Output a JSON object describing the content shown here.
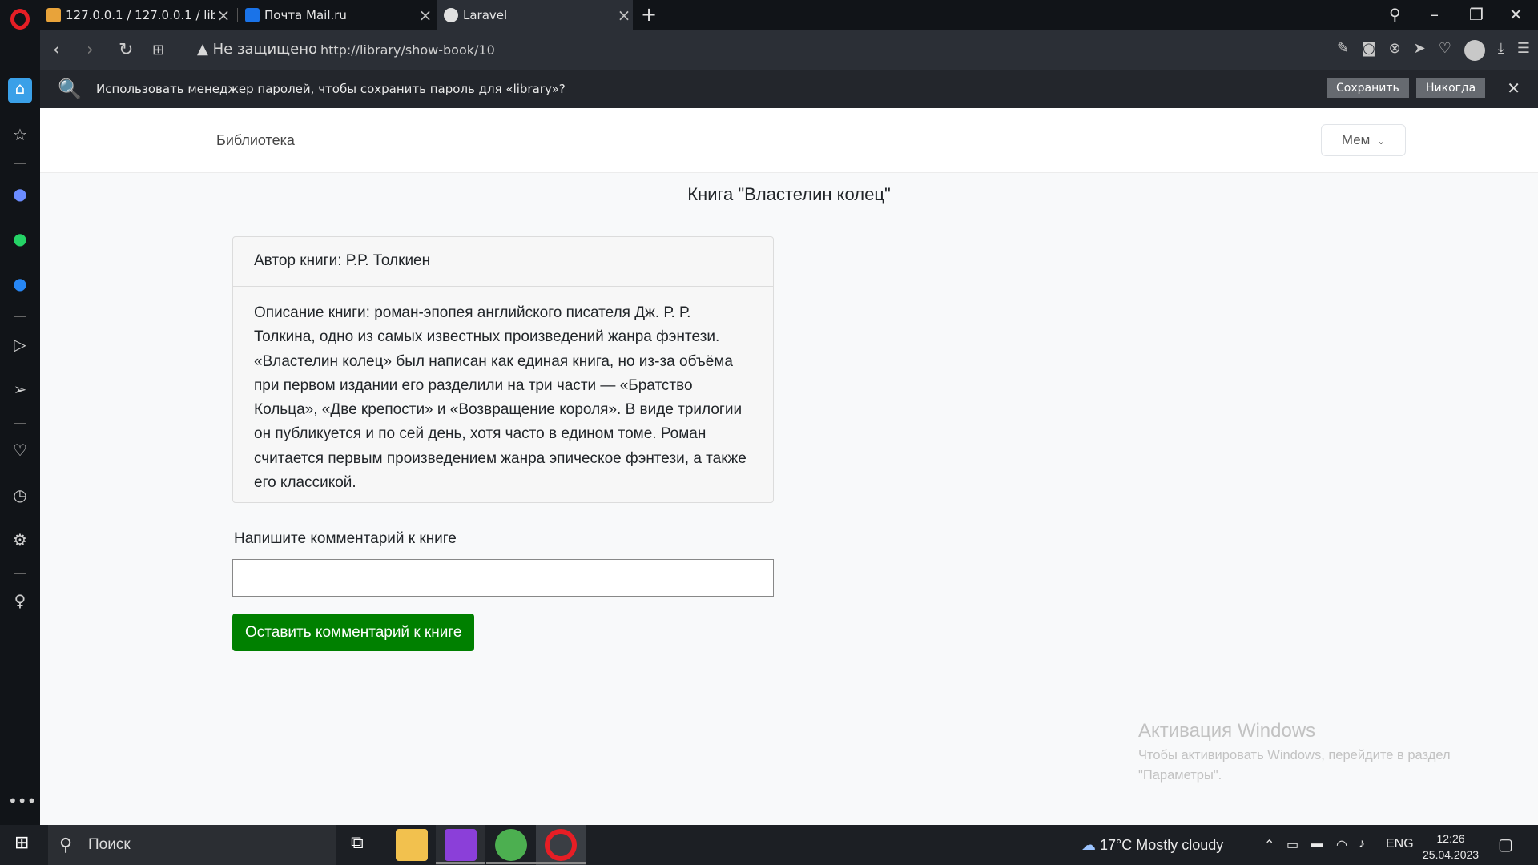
{
  "browser": {
    "tabs": [
      {
        "title": "127.0.0.1 / 127.0.0.1 / library",
        "icon": "phpmyadmin-icon"
      },
      {
        "title": "Почта Mail.ru",
        "icon": "mail-icon"
      },
      {
        "title": "Laravel",
        "icon": "globe-icon"
      }
    ],
    "security_label": "Не защищено",
    "url": "http://library/show-book/10"
  },
  "password_bar": {
    "message": "Использовать менеджер паролей, чтобы сохранить пароль для «library»?",
    "save_label": "Сохранить",
    "never_label": "Никогда"
  },
  "site": {
    "brand": "Библиотека",
    "user_label": "Мем",
    "book_title": "Книга \"Властелин колец\"",
    "author_line": "Автор книги: Р.Р. Толкиен",
    "description": "Описание книги: роман-эпопея английского писателя Дж. Р. Р. Толкина, одно из самых известных произведений жанра фэнтези. «Властелин колец» был написан как единая книга, но из-за объёма при первом издании его разделили на три части — «Братство Кольца», «Две крепости» и «Возвращение короля». В виде трилогии он публикуется и по сей день, хотя часто в едином томе. Роман считается первым произведением жанра эпическое фэнтези, а также его классикой.",
    "comment_label": "Напишите комментарий к книге",
    "comment_value": "",
    "comment_button": "Оставить комментарий к книге"
  },
  "watermark": {
    "title": "Активация Windows",
    "body": "Чтобы активировать Windows, перейдите в раздел \"Параметры\"."
  },
  "taskbar": {
    "search_placeholder": "Поиск",
    "weather": "17°C  Mostly cloudy",
    "language": "ENG",
    "time": "12:26",
    "date": "25.04.2023"
  },
  "colors": {
    "comment_button": "#008000",
    "browser_accent": "#e61e25"
  }
}
